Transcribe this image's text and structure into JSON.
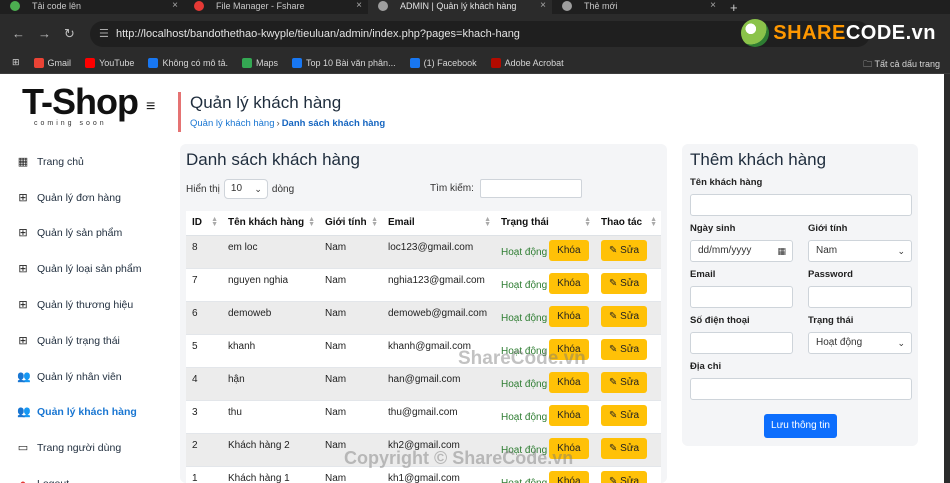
{
  "browser": {
    "tabs": [
      {
        "title": "Tải code lên",
        "color": "#4caf50",
        "active": false
      },
      {
        "title": "File Manager - Fshare",
        "color": "#e53935",
        "active": false
      },
      {
        "title": "ADMIN | Quản lý khách hàng",
        "color": "#9e9e9e",
        "active": true
      },
      {
        "title": "Thẻ mới",
        "color": "#9e9e9e",
        "active": false
      }
    ],
    "new_tab": "+",
    "url": "http://localhost/bandothethao-kwyple/tieuluan/admin/index.php?pages=khach-hang",
    "logo_text_a": "SHARE",
    "logo_text_b": "CODE.vn",
    "bookmarks": [
      {
        "label": "Gmail",
        "color": "#ea4335"
      },
      {
        "label": "YouTube",
        "color": "#ff0000"
      },
      {
        "label": "Không có mô tả.",
        "color": "#1877f2"
      },
      {
        "label": "Maps",
        "color": "#34a853"
      },
      {
        "label": "Top 10 Bài văn phân...",
        "color": "#1877f2"
      },
      {
        "label": "(1) Facebook",
        "color": "#1877f2"
      },
      {
        "label": "Adobe Acrobat",
        "color": "#b30b00"
      }
    ],
    "bookmarks_all": "Tất cả dấu trang"
  },
  "sidebar": {
    "brand": "T-Shop",
    "brand_sub": "coming soon",
    "items": [
      {
        "label": "Trang chủ",
        "icon": "dashboard-icon",
        "glyph": "▦",
        "active": false
      },
      {
        "label": "Quản lý đơn hàng",
        "icon": "grid-icon",
        "glyph": "⊞",
        "active": false
      },
      {
        "label": "Quản lý sản phẩm",
        "icon": "grid-icon",
        "glyph": "⊞",
        "active": false
      },
      {
        "label": "Quản lý loại sản phẩm",
        "icon": "grid-icon",
        "glyph": "⊞",
        "active": false
      },
      {
        "label": "Quản lý thương hiệu",
        "icon": "grid-icon",
        "glyph": "⊞",
        "active": false
      },
      {
        "label": "Quản lý trạng thái",
        "icon": "grid-icon",
        "glyph": "⊞",
        "active": false
      },
      {
        "label": "Quản lý nhân viên",
        "icon": "users-icon",
        "glyph": "👥",
        "active": false
      },
      {
        "label": "Quản lý khách hàng",
        "icon": "users-icon",
        "glyph": "👥",
        "active": true
      },
      {
        "label": "Trang người dùng",
        "icon": "monitor-icon",
        "glyph": "▭",
        "active": false
      },
      {
        "label": "Logout",
        "icon": "logout-icon",
        "glyph": "●",
        "active": false
      }
    ]
  },
  "header": {
    "title": "Quản lý khách hàng",
    "crumb_1": "Quản lý khách hàng",
    "crumb_sep": "›",
    "crumb_2": "Danh sách khách hàng"
  },
  "list": {
    "title": "Danh sách khách hàng",
    "show_label": "Hiển thị",
    "page_size": "10",
    "rows_label": "dòng",
    "search_label": "Tìm kiếm:",
    "columns": [
      "ID",
      "Tên khách hàng",
      "Giới tính",
      "Email",
      "Trạng thái",
      "Thao tác"
    ],
    "lock_label": "Khóa",
    "edit_label": "Sửa",
    "rows": [
      {
        "id": "8",
        "name": "em loc",
        "gender": "Nam",
        "email": "loc123@gmail.com",
        "status": "Hoạt động"
      },
      {
        "id": "7",
        "name": "nguyen nghia",
        "gender": "Nam",
        "email": "nghia123@gmail.com",
        "status": "Hoạt động"
      },
      {
        "id": "6",
        "name": "demoweb",
        "gender": "Nam",
        "email": "demoweb@gmail.com",
        "status": "Hoạt động"
      },
      {
        "id": "5",
        "name": "khanh",
        "gender": "Nam",
        "email": "khanh@gmail.com",
        "status": "Hoạt động"
      },
      {
        "id": "4",
        "name": "hận",
        "gender": "Nam",
        "email": "han@gmail.com",
        "status": "Hoạt động"
      },
      {
        "id": "3",
        "name": "thu",
        "gender": "Nam",
        "email": "thu@gmail.com",
        "status": "Hoạt động"
      },
      {
        "id": "2",
        "name": "Khách hàng 2",
        "gender": "Nam",
        "email": "kh2@gmail.com",
        "status": "Hoạt động"
      },
      {
        "id": "1",
        "name": "Khách hàng 1",
        "gender": "Nam",
        "email": "kh1@gmail.com",
        "status": "Hoạt động"
      }
    ]
  },
  "form": {
    "title": "Thêm khách hàng",
    "name_label": "Tên khách hàng",
    "dob_label": "Ngày sinh",
    "dob_placeholder": "dd/mm/yyyy",
    "gender_label": "Giới tính",
    "gender_value": "Nam",
    "email_label": "Email",
    "password_label": "Password",
    "phone_label": "Số điện thoại",
    "status_label": "Trạng thái",
    "status_value": "Hoạt động",
    "address_label": "Địa chỉ",
    "save_label": "Lưu thông tin"
  },
  "watermarks": {
    "center": "ShareCode.vn",
    "bottom": "Copyright © ShareCode.vn"
  }
}
